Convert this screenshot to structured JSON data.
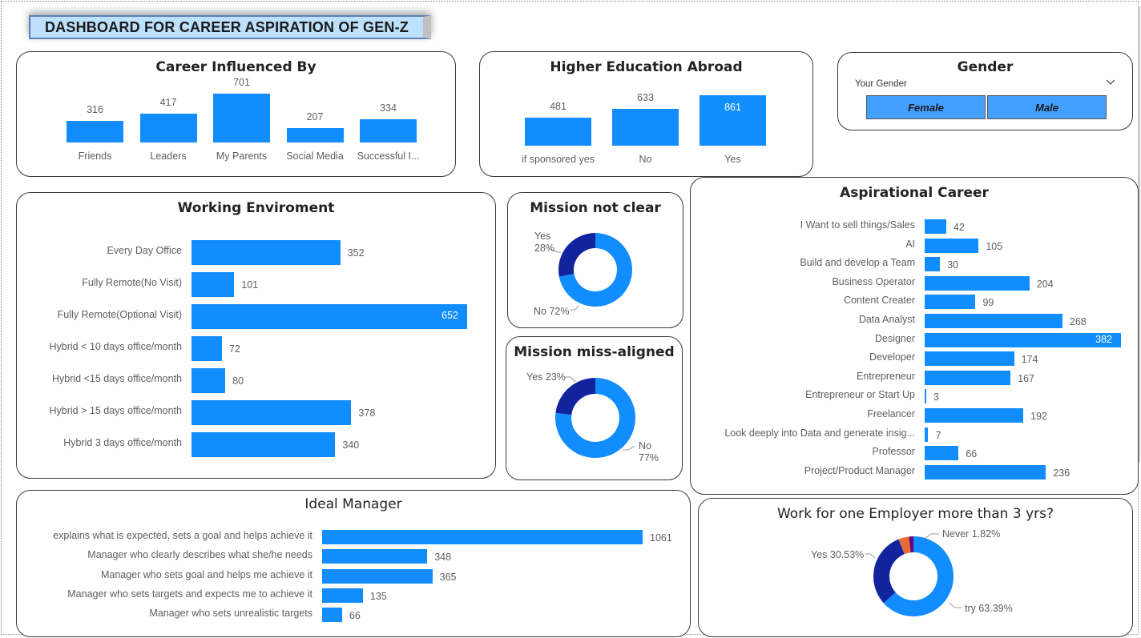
{
  "dashboard_title": "DASHBOARD FOR CAREER ASPIRATION OF GEN-Z",
  "colors": {
    "primary": "#118dff",
    "dark": "#12239e",
    "orange": "#e66c37",
    "purple": "#6b007b",
    "slicer": "#44a0ff"
  },
  "career_influenced": {
    "title": "Career Influenced By",
    "categories": [
      "Friends",
      "Leaders",
      "My Parents",
      "Social Media",
      "Successful I..."
    ],
    "values": [
      316,
      417,
      701,
      207,
      334
    ]
  },
  "higher_education": {
    "title": "Higher Education Abroad",
    "categories": [
      "if sponsored yes",
      "No",
      "Yes"
    ],
    "values": [
      481,
      633,
      861
    ]
  },
  "gender": {
    "title": "Gender",
    "label": "Your Gender",
    "chevron_icon": "chevron-down-icon",
    "options": [
      "Female",
      "Male"
    ]
  },
  "working_env": {
    "title": "Working Enviroment",
    "categories": [
      "Every Day Office",
      "Fully Remote(No Visit)",
      "Fully Remote(Optional Visit)",
      "Hybrid < 10 days office/month",
      "Hybrid <15 days office/month",
      "Hybrid > 15 days office/month",
      "Hybrid 3 days office/month"
    ],
    "values": [
      352,
      101,
      652,
      72,
      80,
      378,
      340
    ]
  },
  "mission_not_clear": {
    "title": "Mission not clear",
    "slices": [
      {
        "label": "Yes",
        "pct": "28%",
        "value": 28
      },
      {
        "label": "No",
        "pct": "72%",
        "value": 72
      }
    ]
  },
  "mission_misaligned": {
    "title": "Mission miss-aligned",
    "slices": [
      {
        "label": "Yes",
        "pct": "23%",
        "value": 23
      },
      {
        "label": "No",
        "pct": "77%",
        "value": 77
      }
    ]
  },
  "aspirational_career": {
    "title": "Aspirational Career",
    "categories": [
      "I Want to sell things/Sales",
      "AI",
      "Build and develop a Team",
      "Business Operator",
      "Content Creater",
      "Data Analyst",
      "Designer",
      "Developer",
      "Entrepreneur",
      "Entrepreneur or Start Up",
      "Freelancer",
      "Look deeply into Data and generate insig...",
      "Professor",
      "Project/Product Manager"
    ],
    "values": [
      42,
      105,
      30,
      204,
      99,
      268,
      382,
      174,
      167,
      3,
      192,
      7,
      66,
      236
    ]
  },
  "ideal_manager": {
    "title": "Ideal Manager",
    "categories": [
      "explains what is expected, sets a goal and helps achieve it",
      "Manager who clearly describes what she/he needs",
      "Manager who sets goal and helps me achieve it",
      "Manager who sets targets and expects me to achieve it",
      "Manager who sets unrealistic targets"
    ],
    "values": [
      1061,
      348,
      365,
      135,
      66
    ]
  },
  "work_one_employer": {
    "title": "Work for one Employer more than 3 yrs?",
    "slices": [
      {
        "label": "Never",
        "pct": "1.82%",
        "value": 1.82
      },
      {
        "label": "Yes",
        "pct": "30.53%",
        "value": 30.53
      },
      {
        "label": "try",
        "pct": "63.39%",
        "value": 63.39
      },
      {
        "label": "",
        "pct": "",
        "value": 4.26
      }
    ]
  },
  "chart_data": [
    {
      "type": "bar",
      "title": "Career Influenced By",
      "categories": [
        "Friends",
        "Leaders",
        "My Parents",
        "Social Media",
        "Successful I..."
      ],
      "values": [
        316,
        417,
        701,
        207,
        334
      ]
    },
    {
      "type": "bar",
      "title": "Higher Education Abroad",
      "categories": [
        "if sponsored yes",
        "No",
        "Yes"
      ],
      "values": [
        481,
        633,
        861
      ]
    },
    {
      "type": "bar",
      "title": "Working Enviroment",
      "categories": [
        "Every Day Office",
        "Fully Remote(No Visit)",
        "Fully Remote(Optional Visit)",
        "Hybrid < 10 days office/month",
        "Hybrid <15 days office/month",
        "Hybrid > 15 days office/month",
        "Hybrid 3 days office/month"
      ],
      "values": [
        352,
        101,
        652,
        72,
        80,
        378,
        340
      ]
    },
    {
      "type": "pie",
      "title": "Mission not clear",
      "categories": [
        "Yes",
        "No"
      ],
      "values": [
        28,
        72
      ]
    },
    {
      "type": "pie",
      "title": "Mission miss-aligned",
      "categories": [
        "Yes",
        "No"
      ],
      "values": [
        23,
        77
      ]
    },
    {
      "type": "bar",
      "title": "Aspirational Career",
      "categories": [
        "I Want to sell things/Sales",
        "AI",
        "Build and develop a Team",
        "Business Operator",
        "Content Creater",
        "Data Analyst",
        "Designer",
        "Developer",
        "Entrepreneur",
        "Entrepreneur or Start Up",
        "Freelancer",
        "Look deeply into Data and generate insig...",
        "Professor",
        "Project/Product Manager"
      ],
      "values": [
        42,
        105,
        30,
        204,
        99,
        268,
        382,
        174,
        167,
        3,
        192,
        7,
        66,
        236
      ]
    },
    {
      "type": "bar",
      "title": "Ideal Manager",
      "categories": [
        "explains what is expected, sets a goal and helps achieve it",
        "Manager who clearly describes what she/he needs",
        "Manager who sets goal and helps me achieve it",
        "Manager who sets targets and expects me to achieve it",
        "Manager who sets unrealistic targets"
      ],
      "values": [
        1061,
        348,
        365,
        135,
        66
      ]
    },
    {
      "type": "pie",
      "title": "Work for one Employer more than 3 yrs?",
      "categories": [
        "Never",
        "Yes",
        "try"
      ],
      "values": [
        1.82,
        30.53,
        63.39
      ]
    }
  ]
}
